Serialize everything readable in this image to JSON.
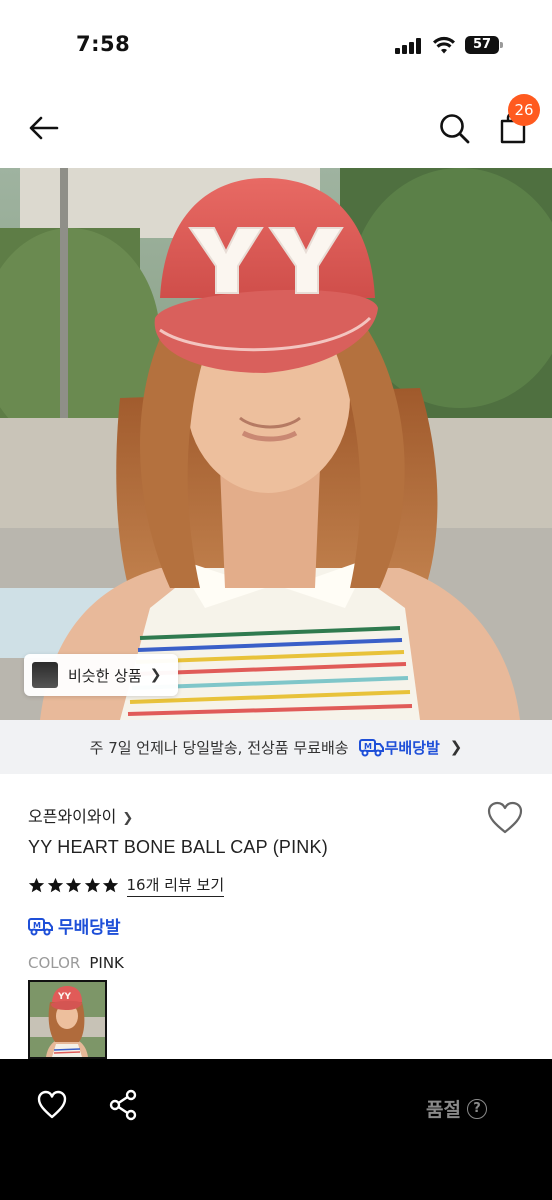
{
  "status_bar": {
    "time": "7:58",
    "battery_level": "57"
  },
  "header": {
    "cart_count": "26"
  },
  "hero": {
    "similar_label": "비슷한 상품"
  },
  "shipping_banner": {
    "text": "주 7일 언제나 당일발송, 전상품 무료배송",
    "service_label": "무배당발"
  },
  "product": {
    "brand": "오픈와이와이",
    "title": "YY HEART BONE BALL CAP (PINK)",
    "rating": 5,
    "review_link": "16개 리뷰 보기",
    "free_shipping_label": "무배당발",
    "option_key": "COLOR",
    "option_value": "PINK"
  },
  "bottom_bar": {
    "soldout_label": "품절",
    "help_label": "?"
  },
  "colors": {
    "accent_badge": "#ff5a1f",
    "shipping_blue": "#1e4fd8",
    "cap_pink": "#e05b58"
  },
  "icons": [
    "back-arrow-icon",
    "search-icon",
    "bag-icon",
    "heart-icon",
    "share-icon",
    "star-icon",
    "truck-icon",
    "help-icon"
  ]
}
